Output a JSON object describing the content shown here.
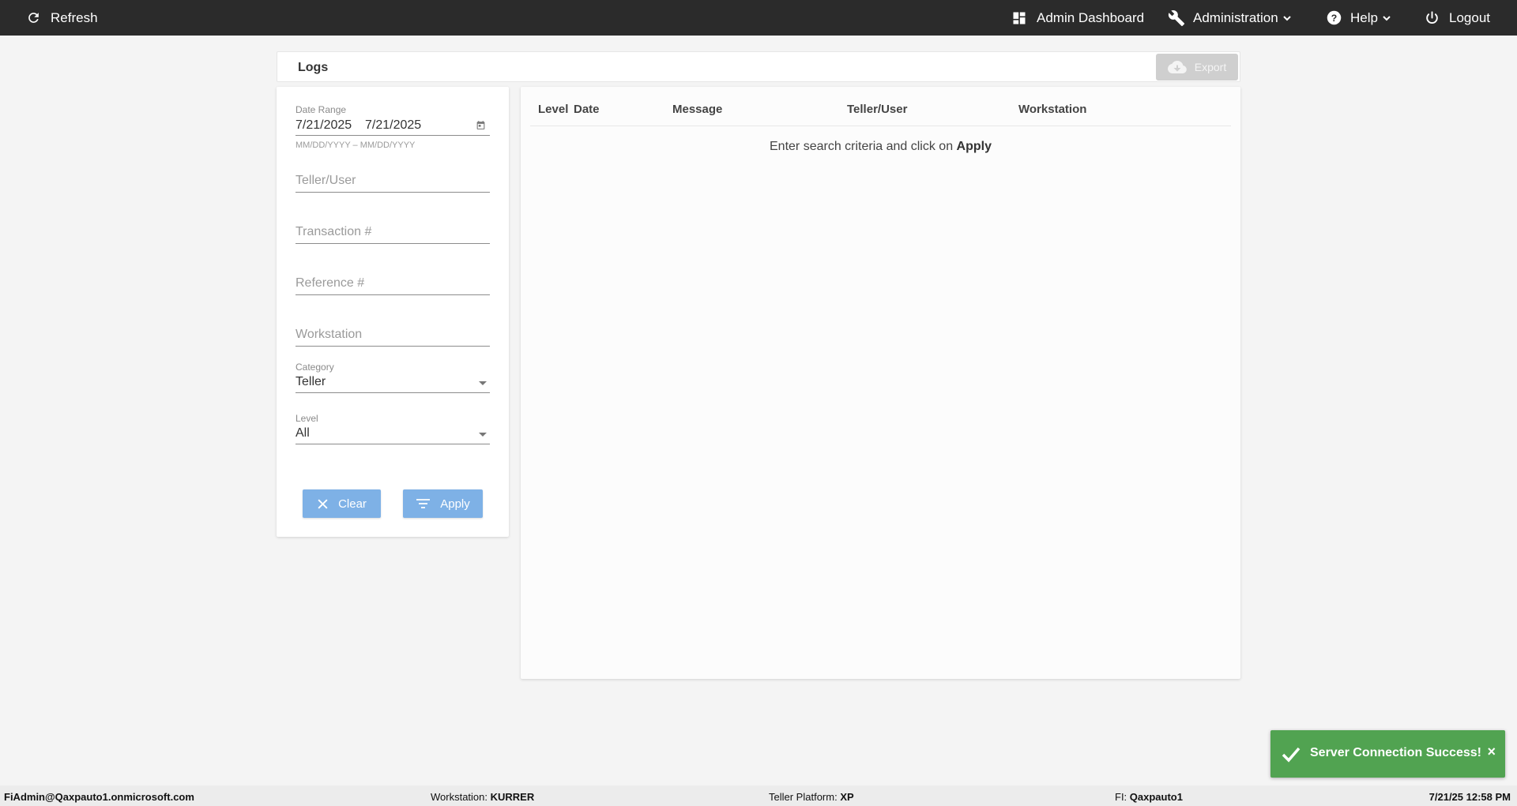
{
  "topbar": {
    "refresh_label": "Refresh",
    "admin_dashboard_label": "Admin Dashboard",
    "administration_label": "Administration",
    "help_label": "Help",
    "logout_label": "Logout"
  },
  "header": {
    "title": "Logs",
    "export_label": "Export"
  },
  "filters": {
    "date_range": {
      "label": "Date Range",
      "start": "7/21/2025",
      "end": "7/21/2025",
      "hint": "MM/DD/YYYY – MM/DD/YYYY"
    },
    "teller_user_placeholder": "Teller/User",
    "transaction_placeholder": "Transaction #",
    "reference_placeholder": "Reference #",
    "workstation_placeholder": "Workstation",
    "category": {
      "label": "Category",
      "value": "Teller"
    },
    "level": {
      "label": "Level",
      "value": "All"
    },
    "clear_label": "Clear",
    "apply_label": "Apply"
  },
  "results": {
    "columns": [
      "Level",
      "Date",
      "Message",
      "Teller/User",
      "Workstation"
    ],
    "empty_text": "Enter search criteria and click on ",
    "empty_emphasis": "Apply"
  },
  "toast": {
    "message": "Server Connection Success!",
    "close": "×"
  },
  "statusbar": {
    "user": "FiAdmin@Qaxpauto1.onmicrosoft.com",
    "workstation_label": "Workstation: ",
    "workstation_value": "KURRER",
    "platform_label": "Teller Platform: ",
    "platform_value": "XP",
    "fi_label": "FI: ",
    "fi_value": "Qaxpauto1",
    "datetime": "7/21/25 12:58 PM"
  },
  "colors": {
    "topbar_bg": "#2b2b2b",
    "primary_button": "#7eb1e6",
    "toast_success": "#51a351",
    "export_disabled": "#cfcfcf"
  }
}
